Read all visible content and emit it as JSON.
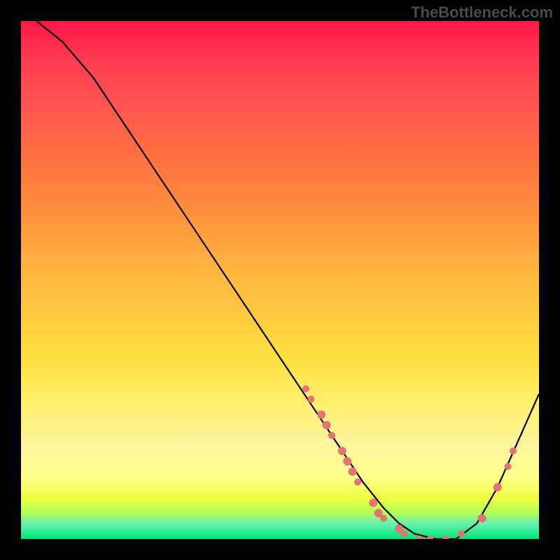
{
  "watermark": "TheBottleneck.com",
  "chart_data": {
    "type": "line",
    "title": "",
    "xlabel": "",
    "ylabel": "",
    "xlim": [
      0,
      100
    ],
    "ylim": [
      0,
      100
    ],
    "curve": {
      "name": "bottleneck-curve",
      "x": [
        3,
        8,
        14,
        20,
        26,
        32,
        38,
        44,
        50,
        54,
        58,
        62,
        66,
        70,
        73,
        76,
        80,
        84,
        88,
        92,
        96,
        100
      ],
      "y": [
        100,
        96,
        89,
        80,
        71,
        62,
        53,
        44,
        35,
        29,
        23,
        17,
        11,
        6,
        3,
        1,
        0,
        0,
        3,
        10,
        19,
        28
      ]
    },
    "markers": {
      "name": "highlighted-points",
      "color": "#e57373",
      "points": [
        {
          "x": 55,
          "y": 29,
          "r": 5
        },
        {
          "x": 56,
          "y": 27,
          "r": 5
        },
        {
          "x": 58,
          "y": 24,
          "r": 6
        },
        {
          "x": 59,
          "y": 22,
          "r": 6
        },
        {
          "x": 60,
          "y": 20,
          "r": 5
        },
        {
          "x": 62,
          "y": 17,
          "r": 6
        },
        {
          "x": 63,
          "y": 15,
          "r": 6
        },
        {
          "x": 64,
          "y": 13,
          "r": 6
        },
        {
          "x": 65,
          "y": 11,
          "r": 5
        },
        {
          "x": 68,
          "y": 7,
          "r": 6
        },
        {
          "x": 69,
          "y": 5,
          "r": 6
        },
        {
          "x": 70,
          "y": 4,
          "r": 5
        },
        {
          "x": 73,
          "y": 2,
          "r": 6
        },
        {
          "x": 74,
          "y": 1,
          "r": 5
        },
        {
          "x": 77,
          "y": 0,
          "r": 5
        },
        {
          "x": 79,
          "y": 0,
          "r": 5
        },
        {
          "x": 82,
          "y": 0,
          "r": 5
        },
        {
          "x": 85,
          "y": 1,
          "r": 5
        },
        {
          "x": 89,
          "y": 4,
          "r": 6
        },
        {
          "x": 92,
          "y": 10,
          "r": 6
        },
        {
          "x": 94,
          "y": 14,
          "r": 5
        },
        {
          "x": 95,
          "y": 17,
          "r": 5
        }
      ]
    }
  }
}
